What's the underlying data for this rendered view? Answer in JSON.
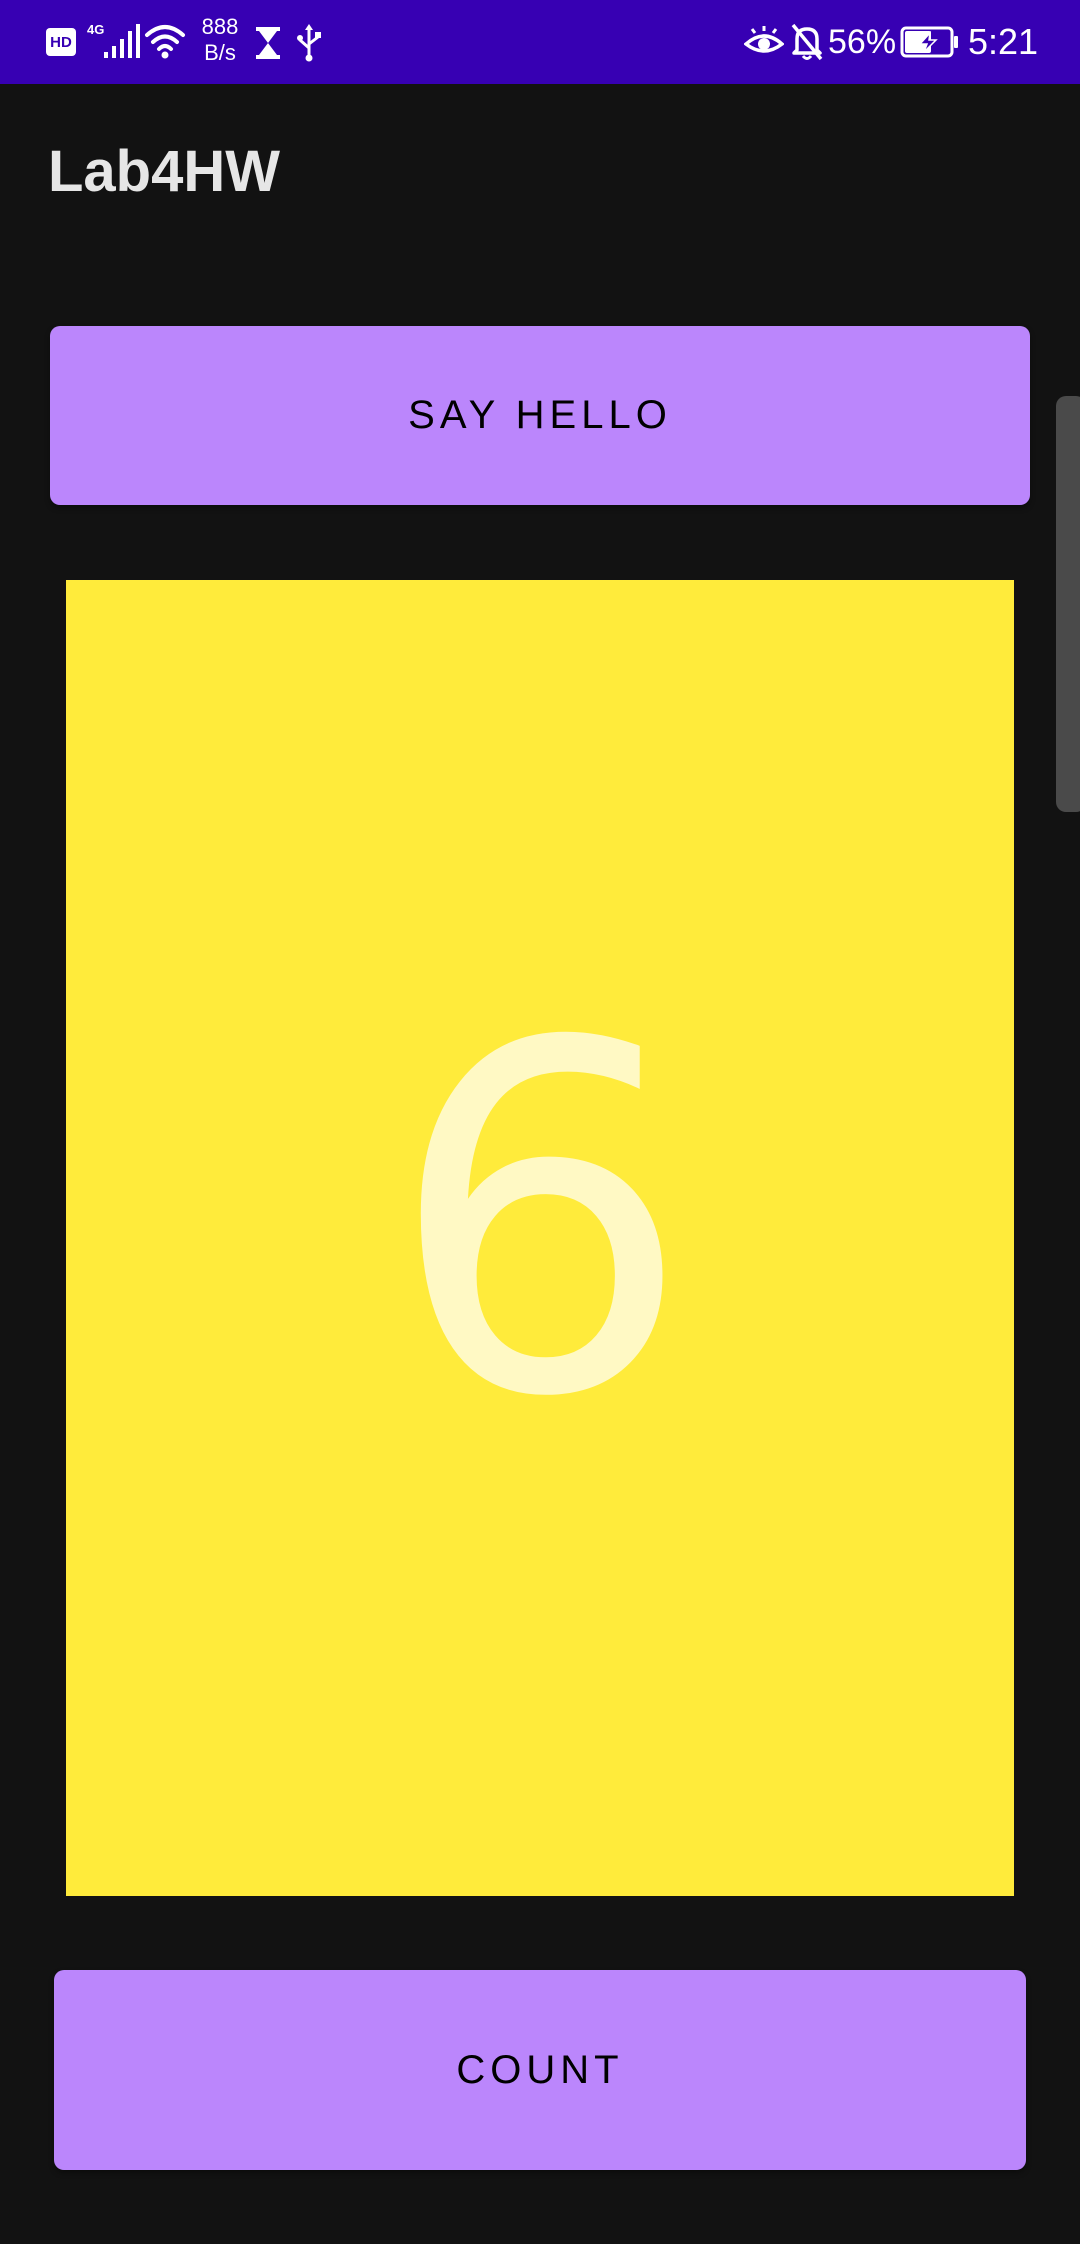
{
  "status_bar": {
    "hd_badge": "HD",
    "network_type": "4G",
    "net_speed_value": "888",
    "net_speed_unit": "B/s",
    "battery_percent": "56%",
    "time": "5:21",
    "icons": [
      "hd-icon",
      "signal-4g-icon",
      "wifi-icon",
      "hourglass-icon",
      "usb-icon",
      "eye-comfort-icon",
      "bell-muted-icon",
      "battery-charging-icon"
    ],
    "background_color": "#3700b3"
  },
  "app_bar": {
    "title": "Lab4HW"
  },
  "buttons": {
    "say_hello_label": "SAY HELLO",
    "count_label": "COUNT",
    "color": "#bb86fc"
  },
  "counter": {
    "value": "6",
    "panel_color": "#ffeb3b",
    "text_color": "#fff9c4"
  }
}
